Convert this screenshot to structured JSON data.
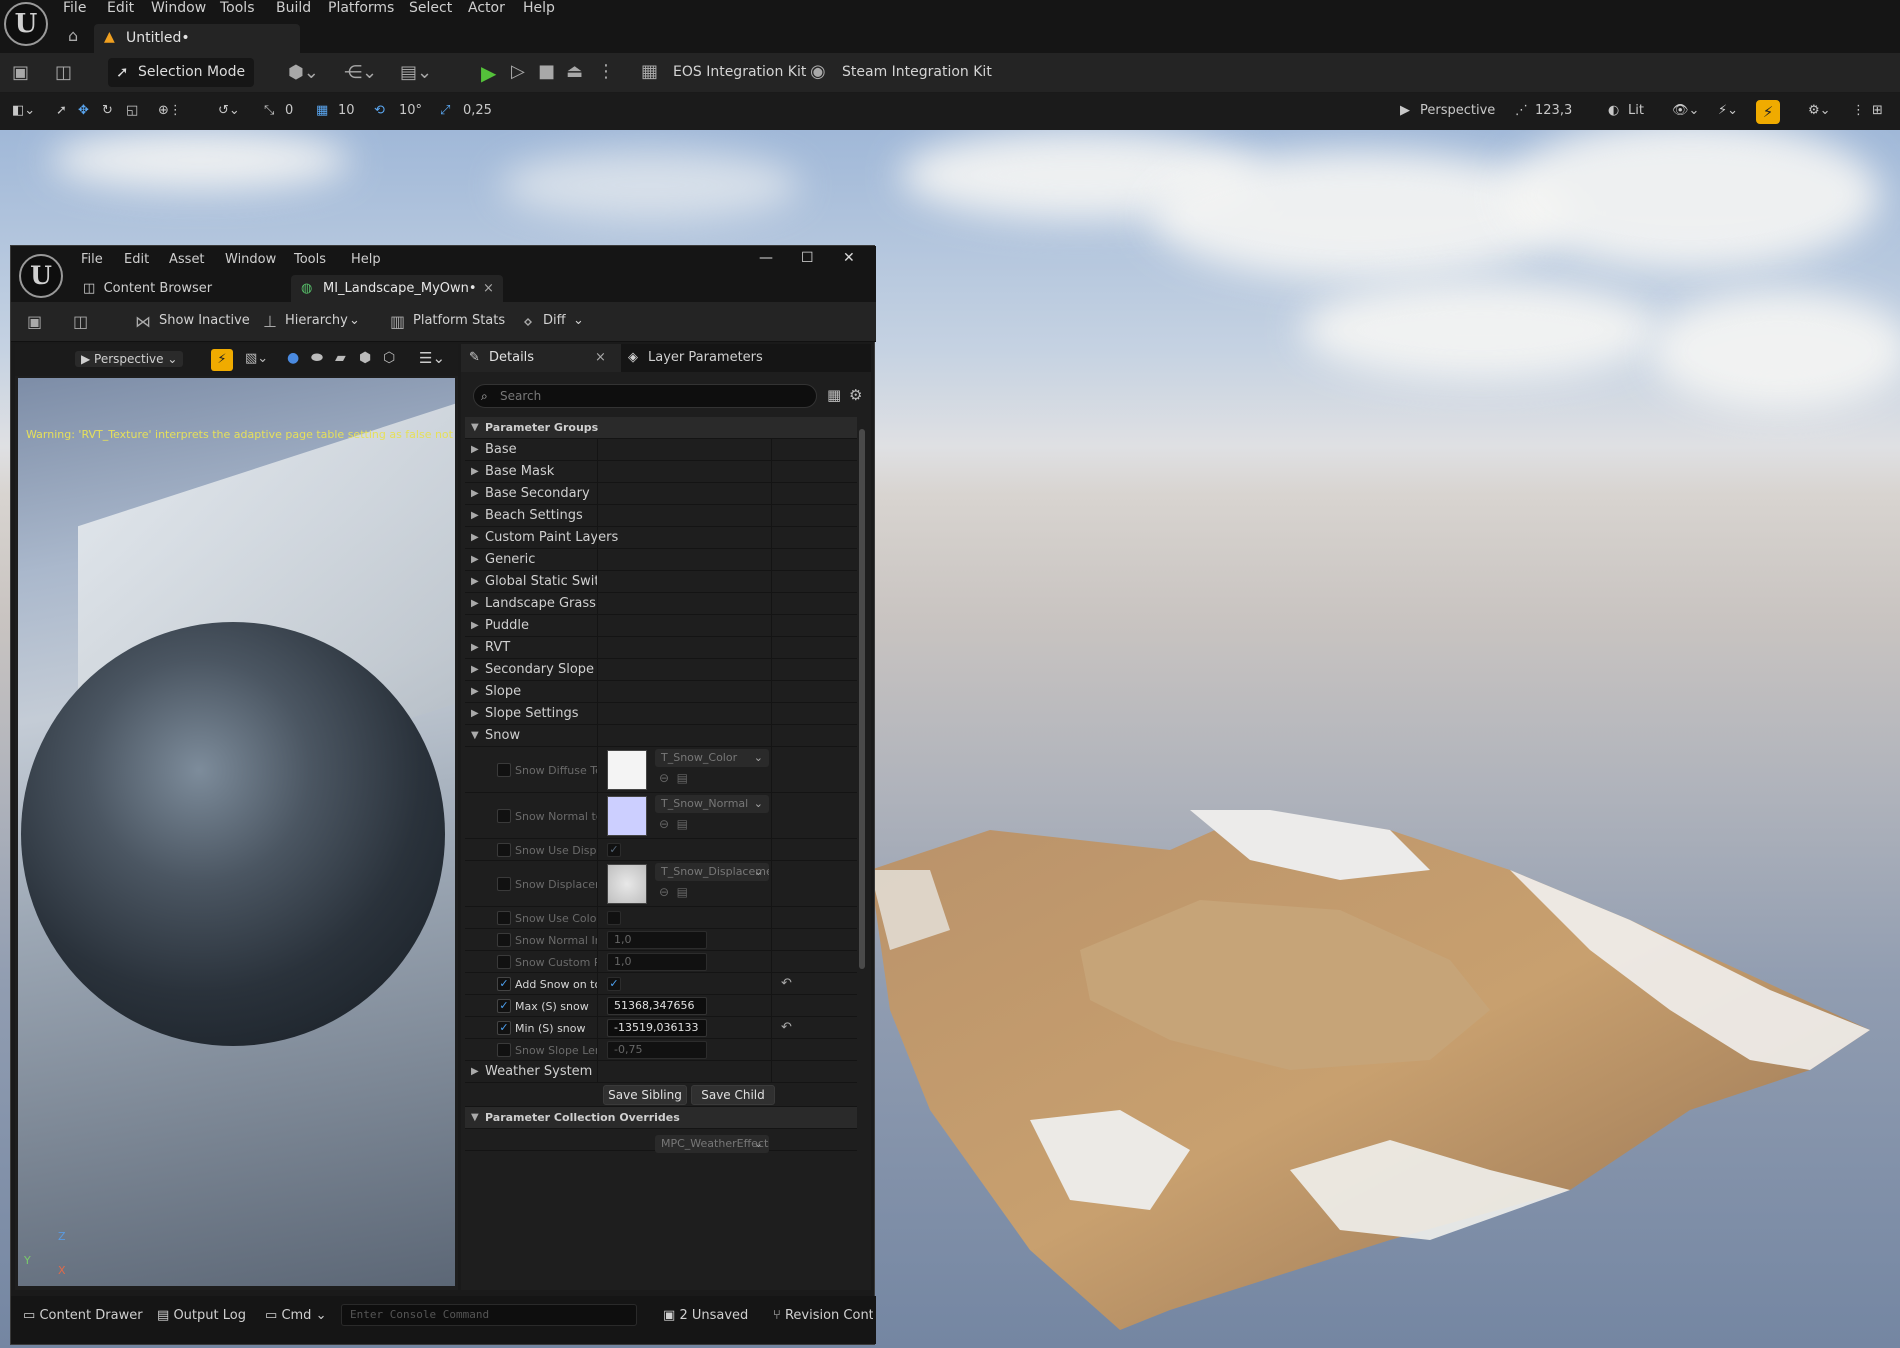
{
  "app": {
    "menu": [
      "File",
      "Edit",
      "Window",
      "Tools",
      "Build",
      "Platforms",
      "Select",
      "Actor",
      "Help"
    ],
    "doc_tab": "Untitled•",
    "toolbar": {
      "selection_mode": "Selection Mode",
      "eos": "EOS Integration Kit",
      "steam": "Steam Integration Kit"
    },
    "viewport_toolbar": {
      "snap_rot": "0",
      "grid": "10",
      "rot": "10°",
      "scale": "0,25",
      "perspective": "Perspective",
      "speed": "123,3",
      "lit": "Lit"
    }
  },
  "material_window": {
    "menu": [
      "File",
      "Edit",
      "Asset",
      "Window",
      "Tools",
      "Help"
    ],
    "tabs": {
      "content_browser": "Content Browser",
      "material": "MI_Landscape_MyOwn•"
    },
    "toolbar": {
      "show_inactive": "Show Inactive",
      "hierarchy": "Hierarchy",
      "platform_stats": "Platform Stats",
      "diff": "Diff"
    },
    "preview": {
      "perspective": "Perspective",
      "warning": "Warning: 'RVT_Texture' interprets the adaptive page table setting as false not true, /Ga",
      "axis_z": "Z",
      "axis_y": "Y",
      "axis_x": "X"
    },
    "details": {
      "tab_details": "Details",
      "tab_layers": "Layer Parameters",
      "search_placeholder": "Search",
      "cat_groups": "Parameter Groups",
      "groups": [
        "Base",
        "Base Mask",
        "Base Secondary",
        "Beach Settings",
        "Custom Paint Layers",
        "Generic",
        "Global Static Switch Pai",
        "Landscape Grass",
        "Puddle",
        "RVT",
        "Secondary Slope",
        "Slope",
        "Slope Settings",
        "Snow"
      ],
      "snow": {
        "diffuse_label": "Snow Diffuse Tex...",
        "diffuse_tex": "T_Snow_Color",
        "normal_label": "Snow Normal tex...",
        "normal_tex": "T_Snow_Normal",
        "use_disp_label": "Snow Use Displac...",
        "disp_label": "Snow Displaceme...",
        "disp_tex": "T_Snow_Displacemei",
        "use_color_label": "Snow Use Color ti...",
        "normal_int_label": "Snow Normal Inte...",
        "normal_int_val": "1,0",
        "custom_ro_label": "Snow Custom Ro...",
        "custom_ro_val": "1,0",
        "add_top_label": "Add Snow on top l...",
        "max_label": "Max (S) snow",
        "max_val": "51368,347656",
        "min_label": "Min (S) snow",
        "min_val": "-13519,036133",
        "slope_lerp_label": "Snow Slope Lerp...",
        "slope_lerp_val": "-0,75"
      },
      "weather": "Weather System",
      "save_sibling": "Save Sibling",
      "save_child": "Save Child",
      "cat_overrides": "Parameter Collection Overrides",
      "mpc": "MPC_WeatherEffects"
    },
    "status": {
      "content_drawer": "Content Drawer",
      "output_log": "Output Log",
      "cmd": "Cmd",
      "console_placeholder": "Enter Console Command",
      "unsaved": "2 Unsaved",
      "revision": "Revision Cont"
    }
  }
}
